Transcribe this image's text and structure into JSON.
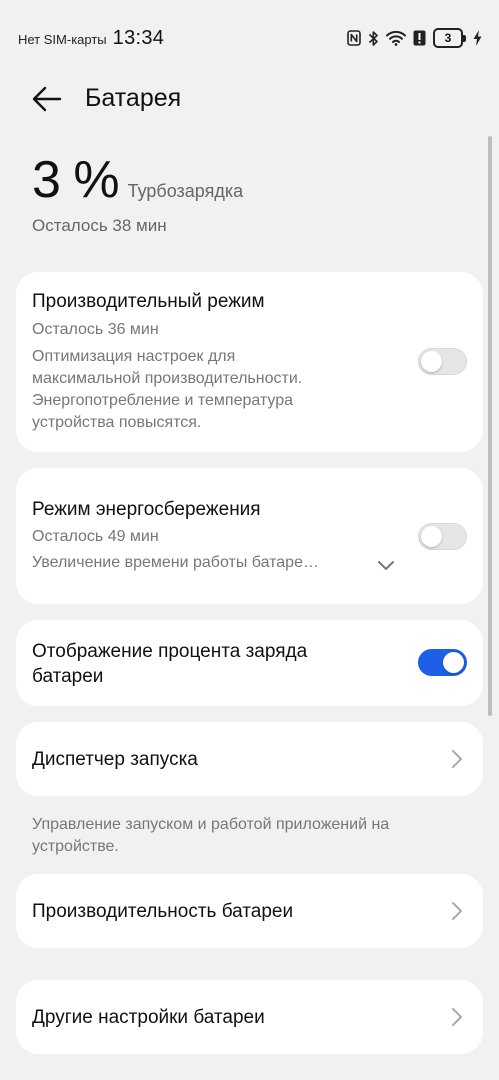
{
  "status_bar": {
    "sim_text": "Нет SIM-карты",
    "time": "13:34",
    "battery_level": "3",
    "icons": [
      "nfc-icon",
      "bluetooth-icon",
      "wifi-icon",
      "alert-icon",
      "battery-icon",
      "charging-icon"
    ]
  },
  "header": {
    "title": "Батарея"
  },
  "battery": {
    "level": "3 %",
    "charge_mode": "Турбозарядка",
    "remaining": "Осталось 38 мин"
  },
  "performance_mode": {
    "title": "Производительный режим",
    "remaining": "Осталось 36 мин",
    "description": [
      "Оптимизация настроек для",
      "максимальной производительности.",
      "Энергопотребление и температура",
      "устройства повысятся."
    ],
    "enabled": false
  },
  "power_saving": {
    "title": "Режим энергосбережения",
    "remaining": "Осталось 49 мин",
    "description": "Увеличение времени работы батаре…",
    "enabled": false
  },
  "battery_percentage": {
    "title_line1": "Отображение процента заряда",
    "title_line2": "батареи",
    "enabled": true
  },
  "launch_manager": {
    "title": "Диспетчер запуска",
    "footnote_line1": "Управление запуском и работой приложений на",
    "footnote_line2": "устройстве."
  },
  "battery_performance": {
    "title": "Производительность батареи"
  },
  "other_settings": {
    "title": "Другие настройки батареи"
  },
  "colors": {
    "accent": "#1d5fe5",
    "background": "#f1f1f3",
    "card": "#ffffff",
    "secondary_text": "#777777"
  }
}
